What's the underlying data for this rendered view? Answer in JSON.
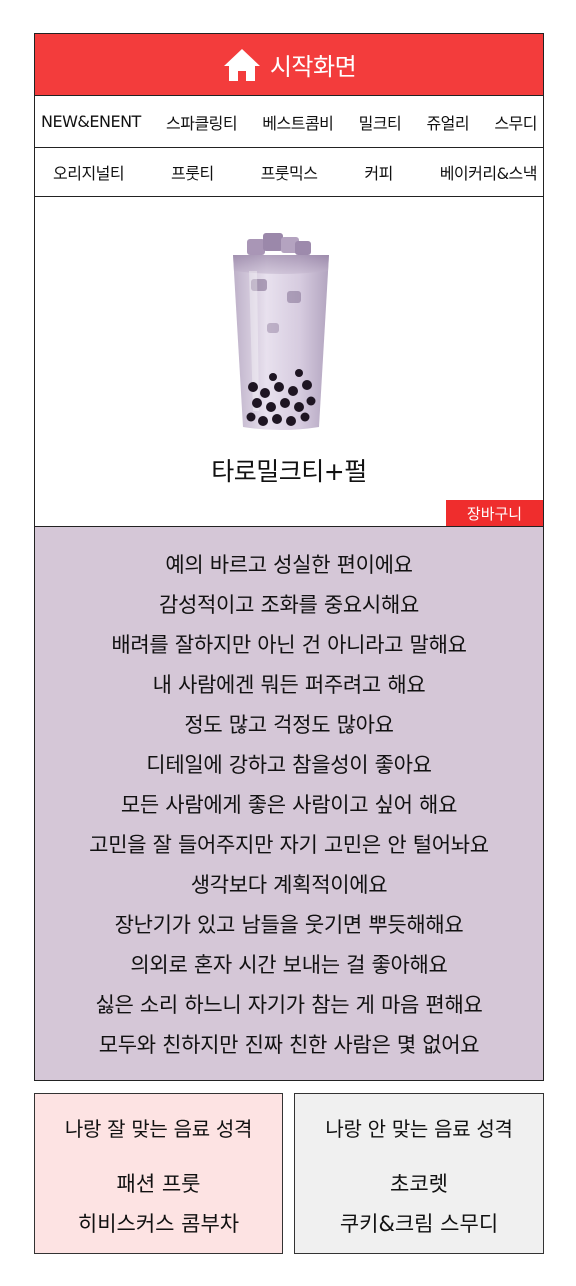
{
  "header": {
    "title": "시작화면",
    "icon": "home-icon"
  },
  "nav": {
    "row1": [
      "NEW&ENENT",
      "스파클링티",
      "베스트콤비",
      "밀크티",
      "쥬얼리",
      "스무디"
    ],
    "row2": [
      "오리지널티",
      "프룻티",
      "프룻믹스",
      "커피",
      "베이커리&스낵"
    ]
  },
  "product": {
    "name": "타로밀크티+펄",
    "cart_label": "장바구니",
    "image": "taro-milk-tea-with-pearls-cup"
  },
  "traits": [
    "예의 바르고 성실한 편이에요",
    "감성적이고 조화를 중요시해요",
    "배려를 잘하지만 아닌 건 아니라고 말해요",
    "내 사람에겐 뭐든 퍼주려고 해요",
    "정도 많고 걱정도 많아요",
    "디테일에 강하고 참을성이 좋아요",
    "모든 사람에게 좋은 사람이고 싶어 해요",
    "고민을 잘 들어주지만 자기 고민은 안 털어놔요",
    "생각보다 계획적이에요",
    "장난기가 있고 남들을 웃기면 뿌듯해해요",
    "의외로 혼자 시간 보내는 걸 좋아해요",
    "싫은 소리 하느니 자기가 참는 게 마음 편해요",
    "모두와 친하지만 진짜 친한 사람은 몇 없어요"
  ],
  "match": {
    "good": {
      "title": "나랑 잘 맞는 음료 성격",
      "items": [
        "패션 프룻",
        "히비스커스 콤부차"
      ]
    },
    "bad": {
      "title": "나랑 안 맞는 음료 성격",
      "items": [
        "초코렛",
        "쿠키&크림 스무디"
      ]
    }
  },
  "colors": {
    "header": "#f33c3c",
    "cart": "#ef2d2d",
    "traits_bg": "#d5c7d7",
    "good_bg": "#fde3e3",
    "bad_bg": "#f0f0f0"
  }
}
